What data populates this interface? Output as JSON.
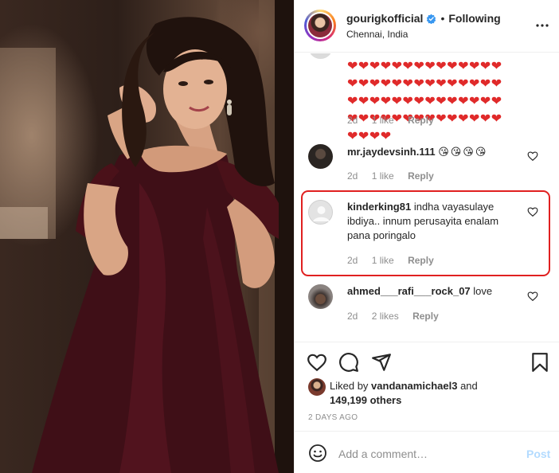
{
  "post": {
    "username": "gourigkofficial",
    "separator": "•",
    "follow_status": "Following",
    "location": "Chennai, India"
  },
  "comments": [
    {
      "username": "",
      "text": "❤❤❤❤❤❤❤❤❤❤❤❤❤❤❤❤❤❤❤❤❤❤❤❤❤❤❤❤❤❤❤❤❤❤❤❤❤❤❤❤❤❤❤❤❤❤❤❤❤❤❤❤❤❤❤❤❤❤❤❤",
      "time": "2d",
      "likes": "1 like",
      "reply": "Reply"
    },
    {
      "username": "mr.jaydevsinh.111",
      "text": "😘😘😘😘",
      "time": "2d",
      "likes": "1 like",
      "reply": "Reply"
    },
    {
      "username": "kinderking81",
      "text": "indha vayasulaye ibdiya.. innum perusayita enalam pana poringalo",
      "time": "2d",
      "likes": "1 like",
      "reply": "Reply"
    },
    {
      "username": "ahmed___rafi___rock_07",
      "text": "love",
      "time": "2d",
      "likes": "2 likes",
      "reply": "Reply"
    }
  ],
  "liked_by": {
    "prefix": "Liked by",
    "user": "vandanamichael3",
    "conj": "and",
    "count": "149,199 others"
  },
  "timestamp": "2 DAYS AGO",
  "comment_box": {
    "placeholder": "Add a comment…",
    "post_label": "Post"
  },
  "colors": {
    "highlight": "#e02020",
    "verified": "#3897f0",
    "post_disabled": "#b3dbff",
    "heart": "#e02a2a"
  },
  "icons": [
    "verified-badge-icon",
    "more-options-icon",
    "like-heart-icon",
    "comment-icon",
    "share-icon",
    "bookmark-icon",
    "emoji-icon"
  ]
}
